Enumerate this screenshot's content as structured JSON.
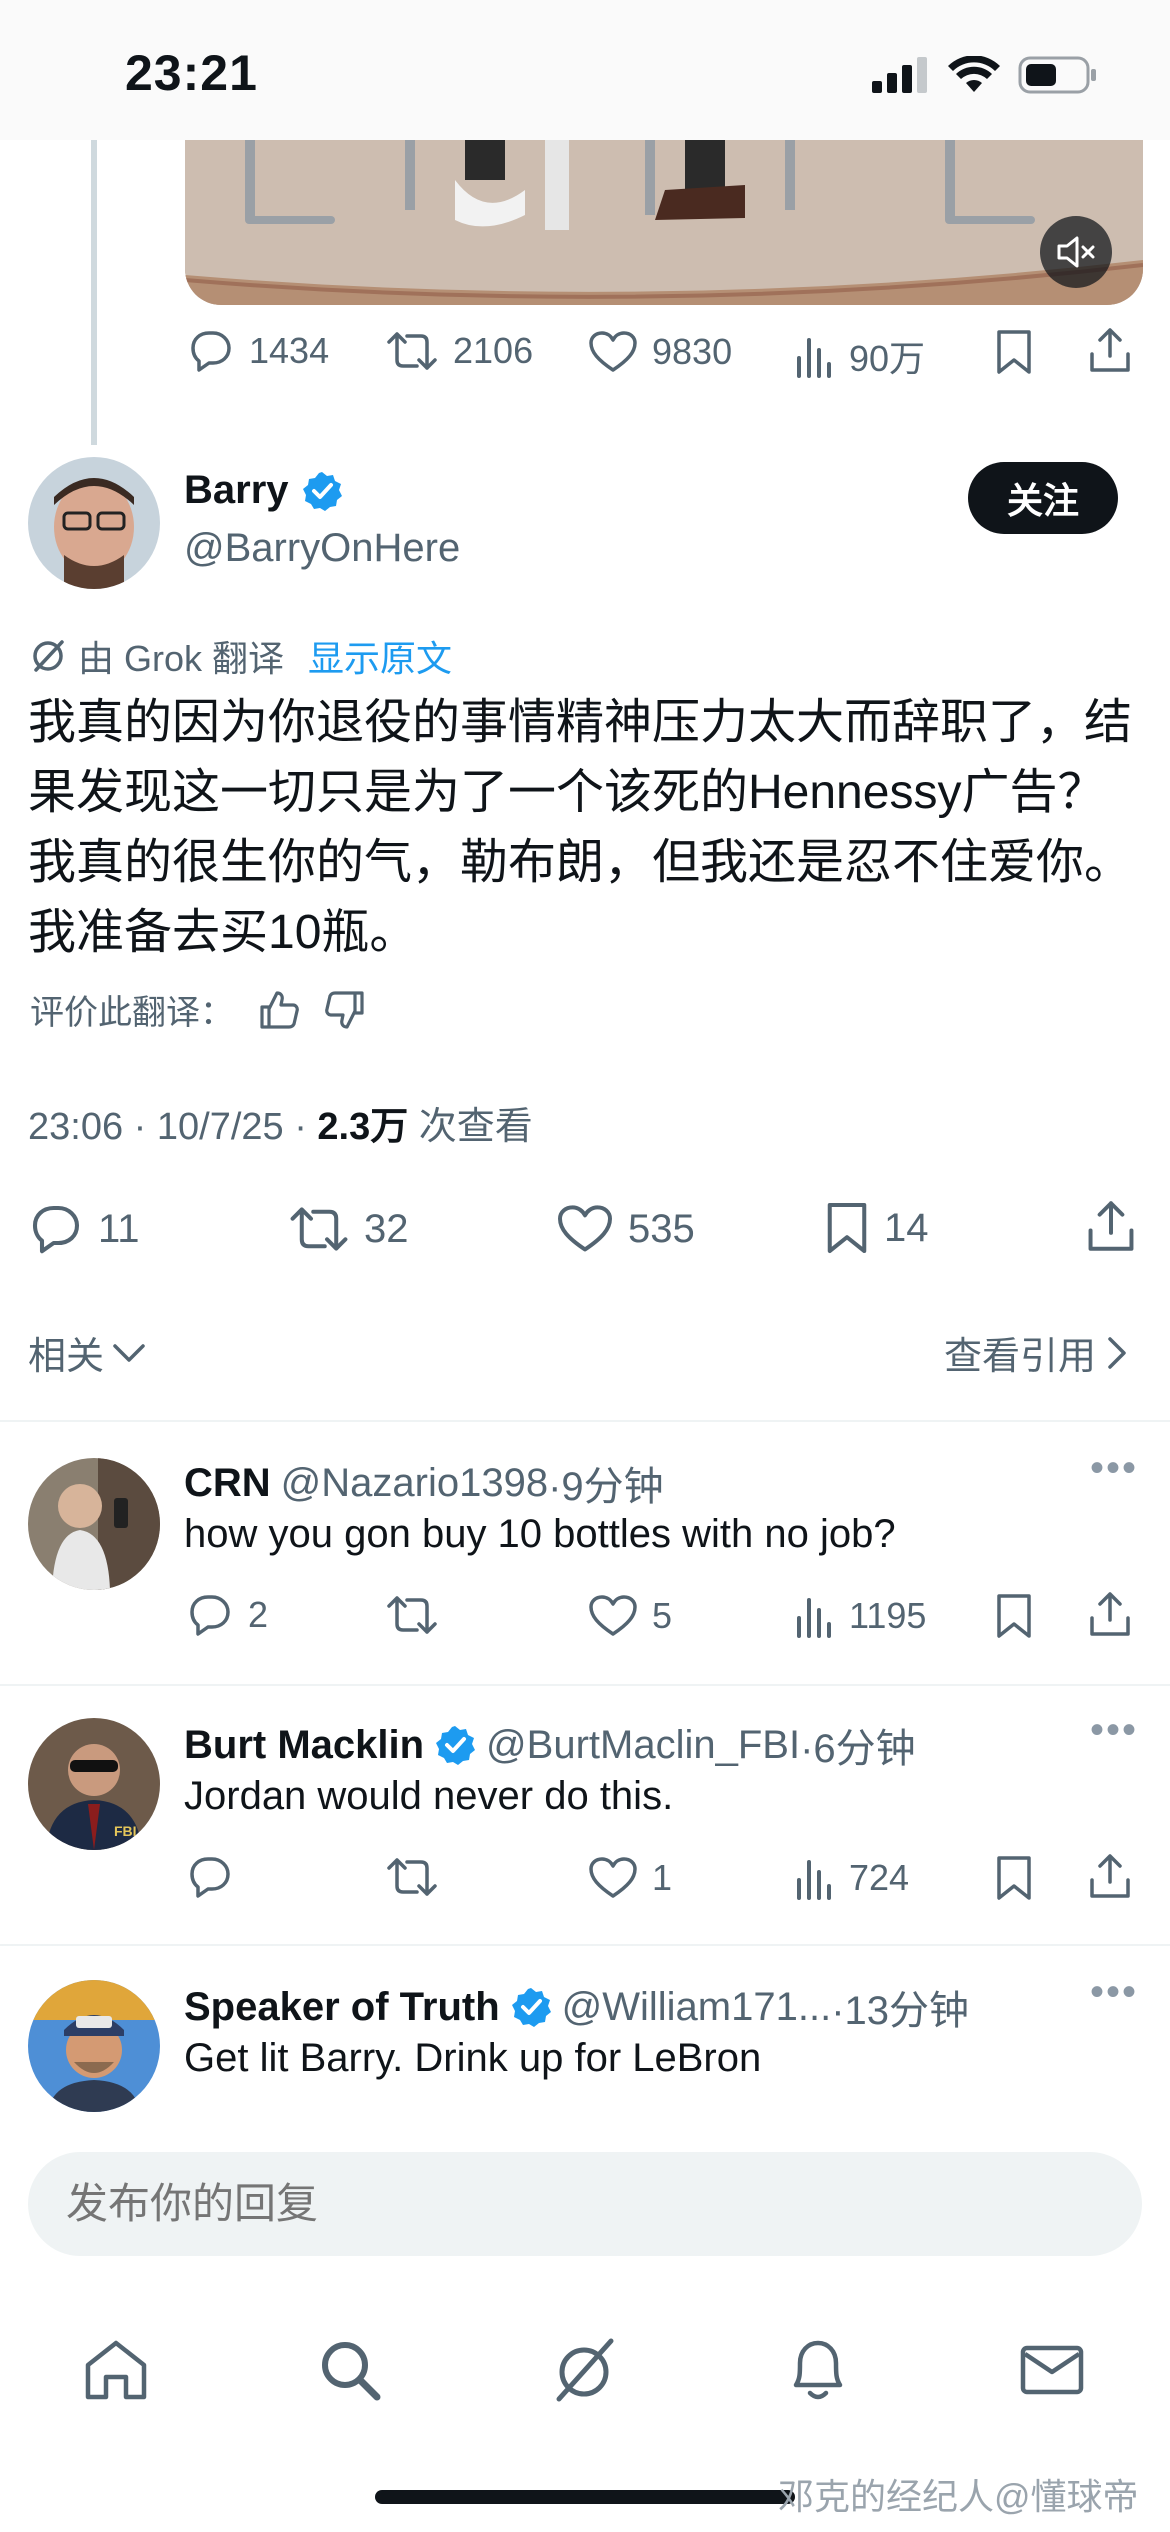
{
  "status_bar": {
    "time": "23:21"
  },
  "prev_tweet": {
    "actions": {
      "replies": "1434",
      "retweets": "2106",
      "likes": "9830",
      "views": "90万"
    }
  },
  "main_tweet": {
    "name": "Barry",
    "handle": "@BarryOnHere",
    "follow_label": "关注",
    "translated_by": "由 Grok 翻译",
    "show_original": "显示原文",
    "text": "我真的因为你退役的事情精神压力太大而辞职了，结果发现这一切只是为了一个该死的Hennessy广告？我真的很生你的气，勒布朗，但我还是忍不住爱你。我准备去买10瓶。",
    "rate_label": "评价此翻译：",
    "time": "23:06 · 10/7/25 · ",
    "view_count": "2.3万",
    "view_label": " 次查看",
    "actions": {
      "replies": "11",
      "retweets": "32",
      "likes": "535",
      "bookmarks": "14"
    },
    "related_label": "相关",
    "quotes_label": "查看引用"
  },
  "replies": [
    {
      "name": "CRN",
      "handle": "@Nazario1398",
      "time": "·9分钟",
      "text": "how you gon buy 10 bottles with no job?",
      "verified": false,
      "replies": "2",
      "retweets": "",
      "likes": "5",
      "views": "1195"
    },
    {
      "name": "Burt Macklin",
      "handle": "@BurtMaclin_FBI",
      "time": "·6分钟",
      "text": "Jordan would never do this.",
      "verified": true,
      "replies": "",
      "retweets": "",
      "likes": "1",
      "views": "724"
    },
    {
      "name": "Speaker of Truth",
      "handle": "@William171...",
      "time": "·13分钟",
      "text": "Get lit Barry. Drink up for LeBron",
      "verified": true,
      "replies": "",
      "retweets": "",
      "likes": "",
      "views": ""
    }
  ],
  "reply_input": {
    "placeholder": "发布你的回复"
  },
  "watermark": "邓克的经纪人@懂球帝",
  "colors": {
    "accent": "#1d9bf0",
    "text": "#0f1419",
    "secondary": "#536471"
  }
}
